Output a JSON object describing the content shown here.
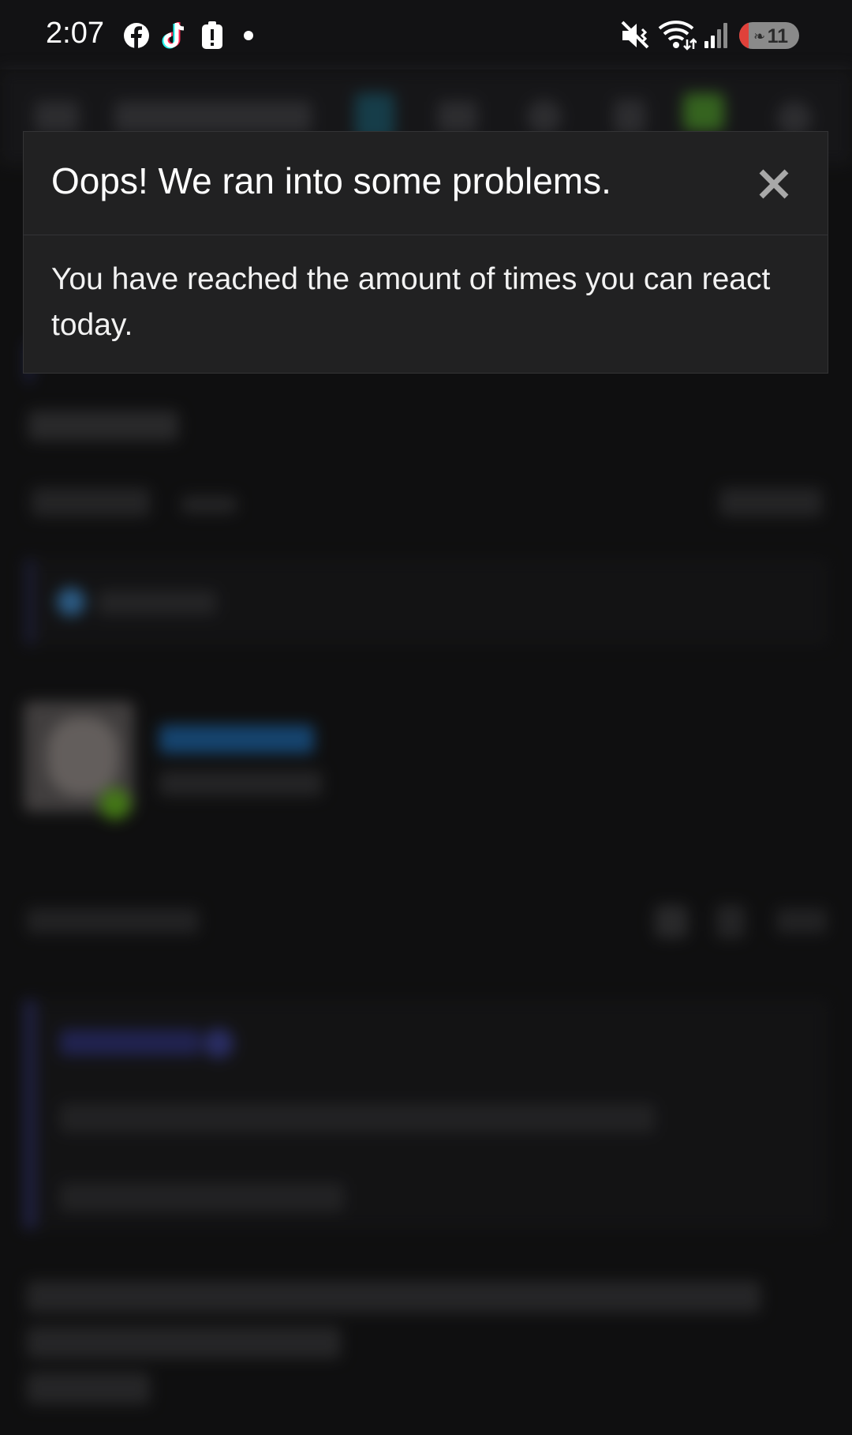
{
  "status_bar": {
    "time": "2:07",
    "battery_level": "11",
    "icons": [
      "facebook-icon",
      "tiktok-icon",
      "alert-icon",
      "dot-icon",
      "mute-icon",
      "wifi-icon",
      "signal-icon",
      "battery-icon"
    ]
  },
  "dialog": {
    "title": "Oops! We ran into some problems.",
    "message": "You have reached the amount of times you can react today.",
    "close_icon": "close-icon"
  },
  "colors": {
    "background": "#161617",
    "dialog_bg": "#212122",
    "dialog_border": "#343436",
    "close_icon": "#a8a8a8"
  }
}
